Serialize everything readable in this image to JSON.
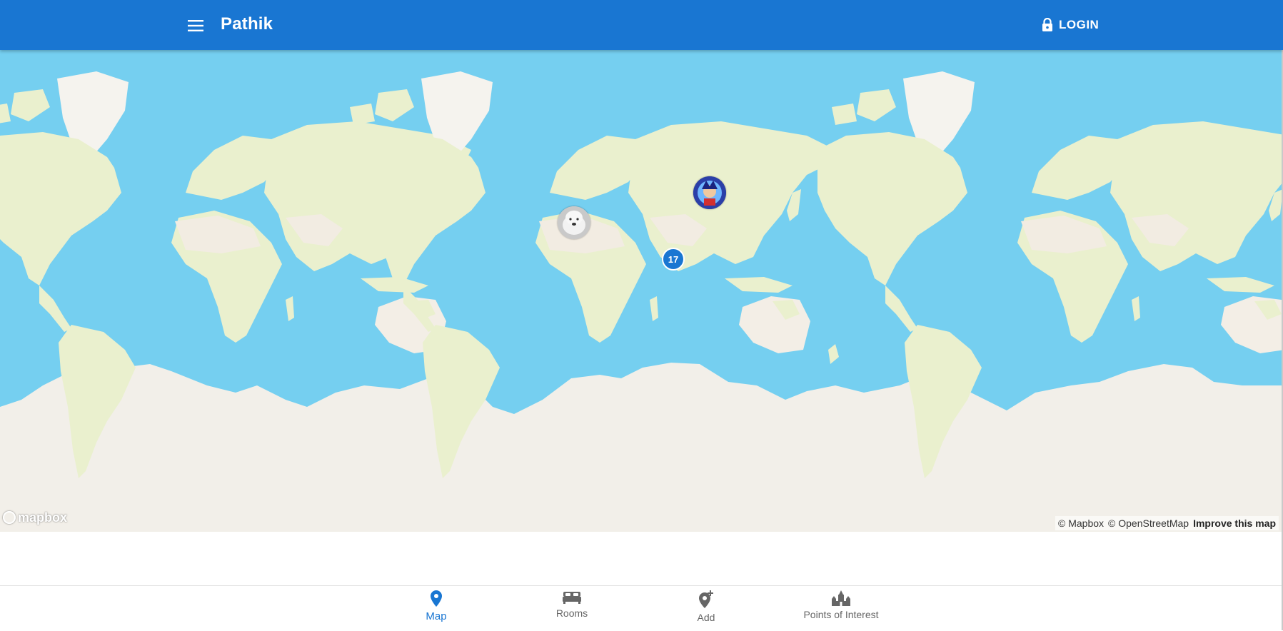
{
  "app": {
    "title": "Pathik"
  },
  "header": {
    "login_label": "LOGIN",
    "menu_icon": "menu-icon",
    "lock_icon": "lock-icon"
  },
  "map": {
    "cluster_count": "17",
    "logo_text": "mapbox",
    "attribution": {
      "mapbox": "© Mapbox",
      "osm": "© OpenStreetMap",
      "improve": "Improve this map"
    },
    "colors": {
      "water": "#75cff0",
      "land": "#eaf0ce",
      "ice": "#f2efe9",
      "marker": "#1976d2"
    }
  },
  "bottom_nav": {
    "items": [
      {
        "label": "Map",
        "icon": "map-pin-icon",
        "active": true
      },
      {
        "label": "Rooms",
        "icon": "bed-icon",
        "active": false
      },
      {
        "label": "Add",
        "icon": "add-location-icon",
        "active": false
      },
      {
        "label": "Points of Interest",
        "icon": "landmark-icon",
        "active": false
      }
    ]
  },
  "theme": {
    "primary": "#1976d2",
    "nav_inactive": "#666666"
  }
}
